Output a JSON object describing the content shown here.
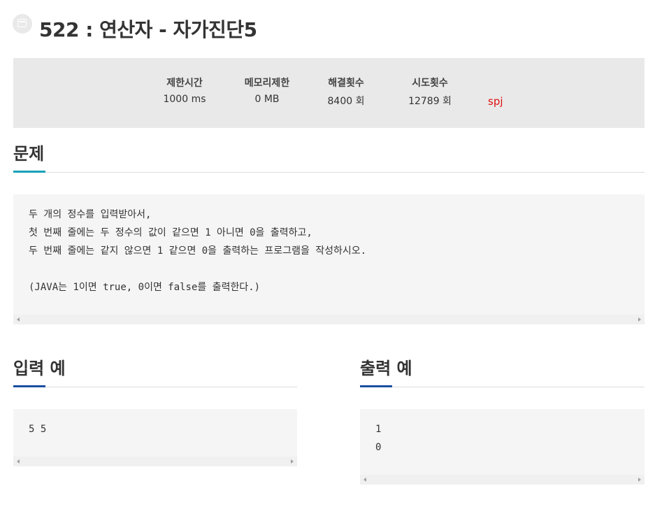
{
  "problem": {
    "title": "522 : 연산자 - 자가진단5"
  },
  "info": {
    "time_limit_label": "제한시간",
    "time_limit_value": "1000 ms",
    "memory_limit_label": "메모리제한",
    "memory_limit_value": "0 MB",
    "solved_label": "해결횟수",
    "solved_value": "8400 회",
    "tries_label": "시도횟수",
    "tries_value": "12789 회",
    "spj": "spj"
  },
  "statement": {
    "heading": "문제",
    "text": "두 개의 정수를 입력받아서,\n첫 번째 줄에는 두 정수의 값이 같으면 1 아니면 0을 출력하고,\n두 번째 줄에는 같지 않으면 1 같으면 0을 출력하는 프로그램을 작성하시오.\n\n(JAVA는 1이면 true, 0이면 false를 출력한다.)"
  },
  "input_example": {
    "heading": "입력 예",
    "text": "5 5"
  },
  "output_example": {
    "heading": "출력 예",
    "text": "1\n0"
  },
  "colors": {
    "accent_teal": "#17a2b8",
    "accent_blue": "#1b4fa0",
    "spj_red": "#e01010"
  }
}
